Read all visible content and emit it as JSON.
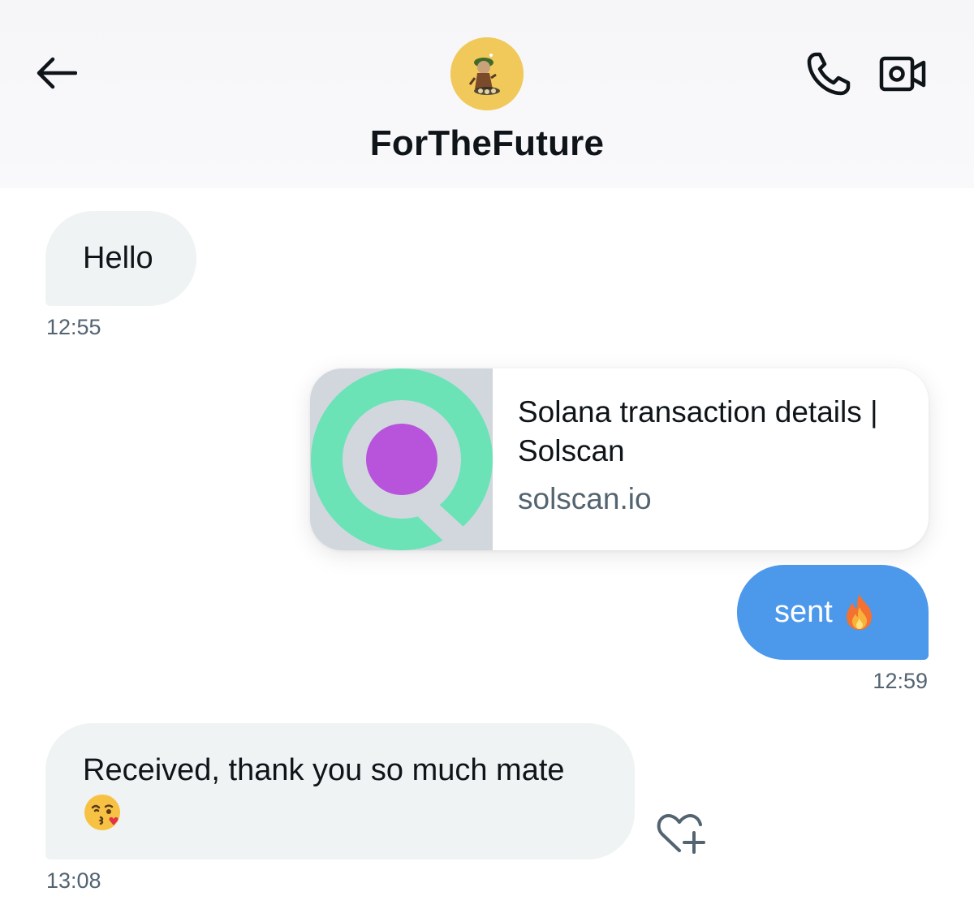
{
  "header": {
    "contact_name": "ForTheFuture",
    "avatar_bg": "#f1c95b",
    "icons": {
      "back": "back-arrow-icon",
      "call": "phone-icon",
      "video": "video-camera-icon"
    }
  },
  "messages": [
    {
      "direction": "incoming",
      "text": "Hello",
      "time": "12:55"
    },
    {
      "direction": "outgoing",
      "type": "link-card",
      "card": {
        "title": "Solana transaction details | Solscan",
        "domain": "solscan.io"
      }
    },
    {
      "direction": "outgoing",
      "text": "sent",
      "emoji": "fire",
      "time": "12:59"
    },
    {
      "direction": "incoming",
      "text": "Received, thank you so much mate",
      "emoji": "face-blowing-kiss",
      "time": "13:08",
      "reaction_icon": "add-reaction-heart-icon"
    }
  ],
  "colors": {
    "outgoing_bubble": "#4c98eb",
    "incoming_bubble": "#eff3f4",
    "timestamp": "#536471",
    "solscan_green": "#6ce3b6",
    "solscan_purple": "#b853db"
  }
}
